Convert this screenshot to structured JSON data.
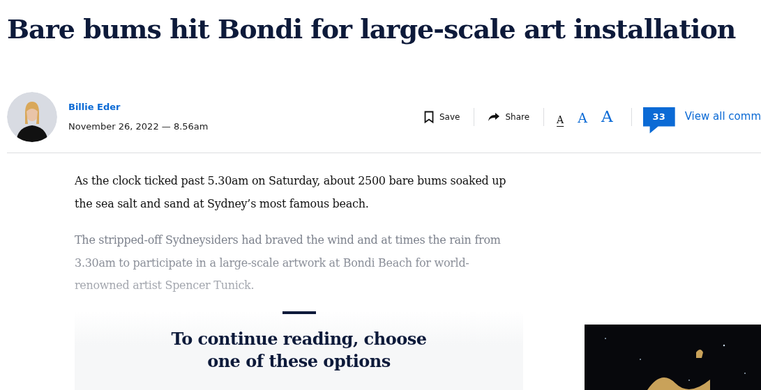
{
  "headline": "Bare bums hit Bondi for large-scale art installation",
  "byline": {
    "author": "Billie Eder",
    "date": "November 26, 2022 — 8.56am"
  },
  "actions": [
    {
      "kind": "save",
      "label": "Save"
    },
    {
      "kind": "share",
      "label": "Share"
    }
  ],
  "font_sizes": [
    {
      "label": "A",
      "selected": true
    },
    {
      "label": "A",
      "selected": false
    },
    {
      "label": "A",
      "selected": false
    }
  ],
  "comments": {
    "count": "33",
    "link": "View all comm"
  },
  "paragraphs": [
    {
      "text": "As the clock ticked past 5.30am on Saturday, about 2500 bare bums soaked up the sea salt and sand at Sydney’s most famous beach.",
      "faded": false
    },
    {
      "text": "The stripped-off Sydneysiders had braved the wind and at times the rain from 3.30am to participate in a large-scale artwork at Bondi Beach for world-renowned artist Spencer Tunick.",
      "faded": true
    }
  ],
  "paywall": {
    "title": "To continue reading, choose one of these options"
  }
}
